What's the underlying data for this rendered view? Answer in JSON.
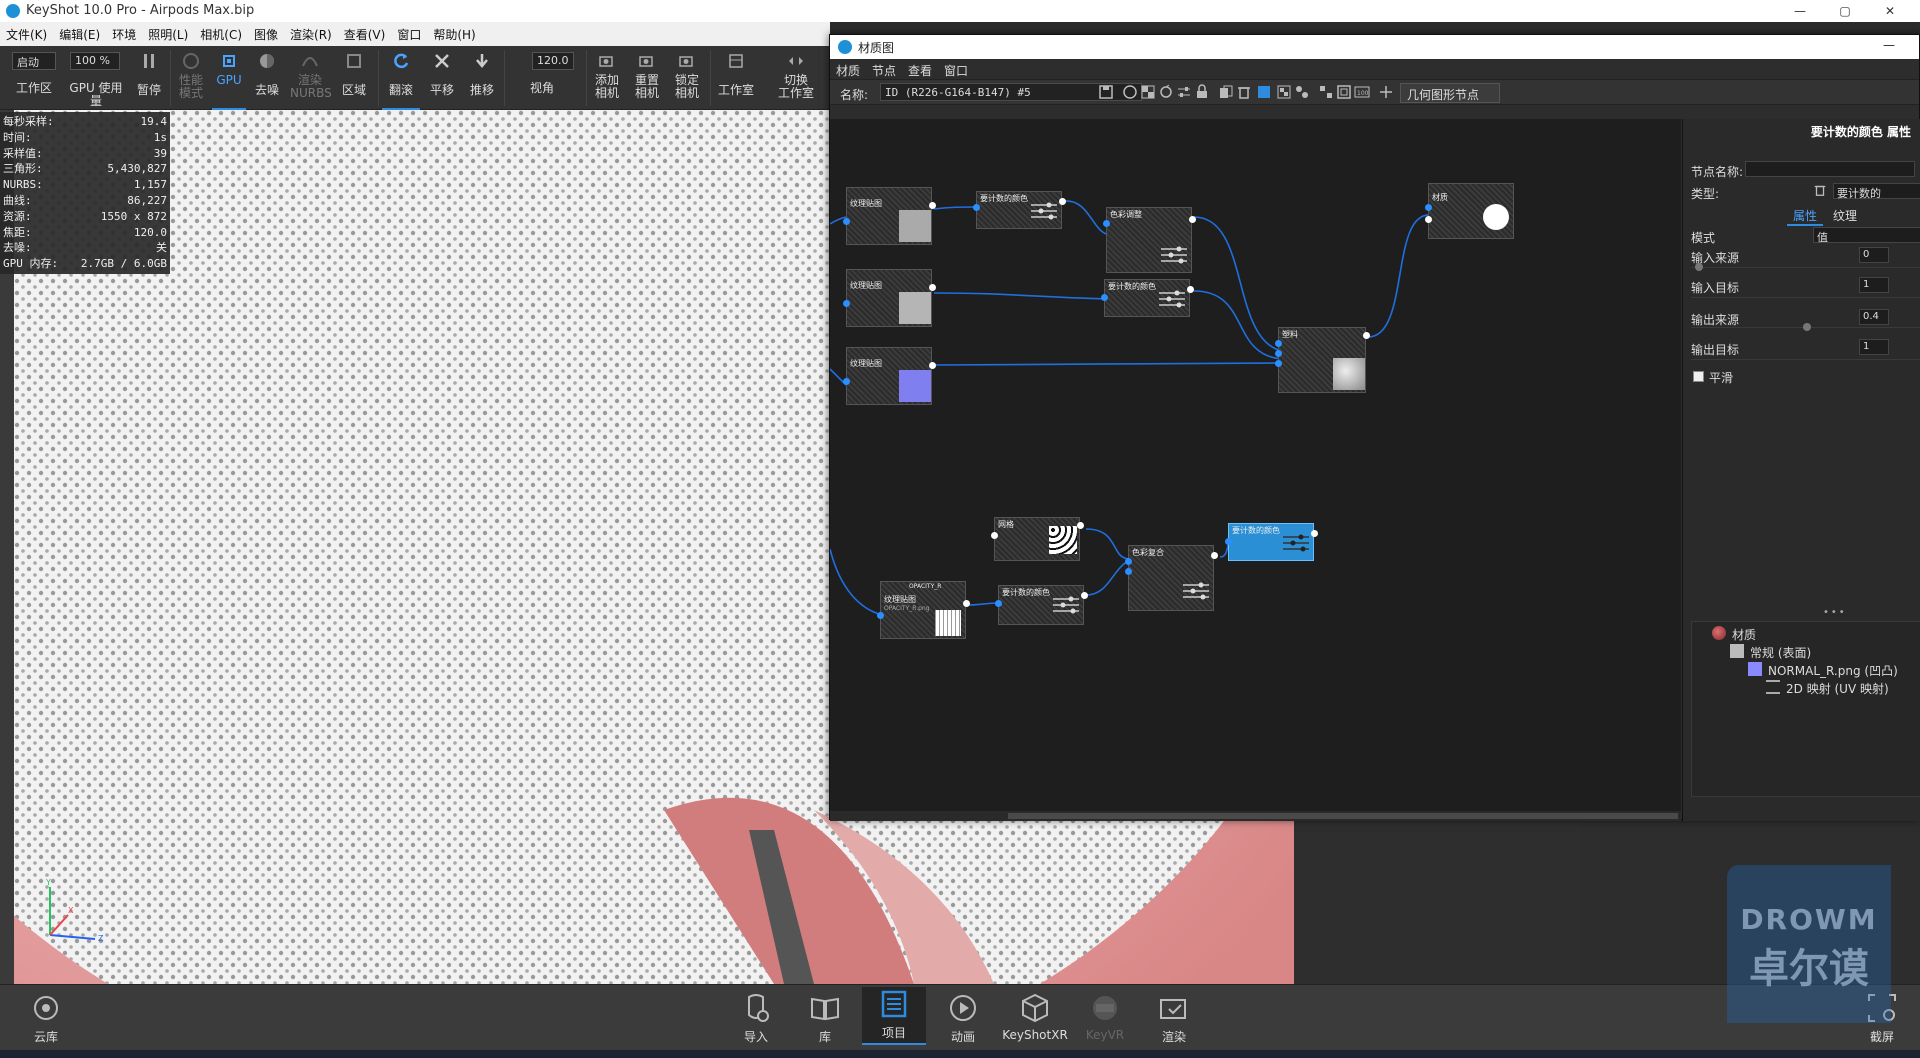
{
  "window": {
    "title": "KeyShot 10.0 Pro  - Airpods Max.bip",
    "minimize": "—",
    "maximize": "▢",
    "close": "✕"
  },
  "menu": [
    "文件(K)",
    "编辑(E)",
    "环境",
    "照明(L)",
    "相机(C)",
    "图像",
    "渲染(R)",
    "查看(V)",
    "窗口",
    "帮助(H)"
  ],
  "toolbar": {
    "start_dropdown": "启动",
    "zoom_value": "100 %",
    "fov_value": "120.0",
    "workspace": "工作区",
    "gpu_usage": "GPU 使用量",
    "pause": "暂停",
    "perf_mode": "性能\n模式",
    "gpu": "GPU",
    "denoise": "去噪",
    "render_nurbs": "渲染\nNURBS",
    "region": "区域",
    "tumble": "翻滚",
    "pan": "平移",
    "dolly": "推移",
    "fov": "视角",
    "add_camera": "添加\n相机",
    "reset_camera": "重置\n相机",
    "lock_camera": "锁定\n相机",
    "studio": "工作室",
    "switch_studio": "切换\n工作室"
  },
  "stats": [
    {
      "label": "每秒采样:",
      "value": "19.4"
    },
    {
      "label": "时间:",
      "value": "1s"
    },
    {
      "label": "采样值:",
      "value": "39"
    },
    {
      "label": "三角形:",
      "value": "5,430,827"
    },
    {
      "label": "NURBS:",
      "value": "1,157"
    },
    {
      "label": "曲线:",
      "value": "86,227"
    },
    {
      "label": "资源:",
      "value": "1550 x 872"
    },
    {
      "label": "焦距:",
      "value": "120.0"
    },
    {
      "label": "去噪:",
      "value": "关"
    },
    {
      "label": "GPU 内存:",
      "value": "2.7GB / 6.0GB"
    }
  ],
  "bottom": {
    "cloud": "云库",
    "import": "导入",
    "library": "库",
    "project": "项目",
    "animation": "动画",
    "keyshotxr": "KeyShotXR",
    "keyvr": "KeyVR",
    "render": "渲染",
    "screenshot": "截屏"
  },
  "material_window": {
    "title": "材质图",
    "minimize": "—",
    "menu": [
      "材质",
      "节点",
      "查看",
      "窗口"
    ],
    "name_label": "名称:",
    "name_value": "ID (R226-G164-B147) #5",
    "geometry_button": "几何图形节点"
  },
  "nodes": {
    "tex1_title": "纹理贴图",
    "tex2_title": "纹理贴图",
    "tex3_title": "纹理贴图",
    "tex4_title": "纹理贴图",
    "count1": "要计数的颜色",
    "count2": "要计数的颜色",
    "count3": "要计数的颜色",
    "count4_selected": "要计数的颜色",
    "adjust": "色彩调整",
    "plastic": "塑料",
    "material": "材质",
    "dots": "网格",
    "composite": "色彩复合",
    "opacity_header": "OPACITY_R",
    "opacity_file": "OPACITY_R.png"
  },
  "props": {
    "header": "要计数的颜色  属性",
    "node_name_label": "节点名称:",
    "node_name_value": "",
    "type_label": "类型:",
    "type_value": "要计数的",
    "tab_properties": "属性",
    "tab_texture": "纹理",
    "mode_label": "模式",
    "mode_value": "值",
    "input_from_label": "输入来源",
    "input_from_value": "0",
    "input_to_label": "输入目标",
    "input_to_value": "1",
    "output_from_label": "输出来源",
    "output_from_value": "0.4",
    "output_to_label": "输出目标",
    "output_to_value": "1",
    "smooth_label": "平滑",
    "dots": "•••"
  },
  "tree": {
    "root": "材质",
    "general": "常规 (表面)",
    "normal": "NORMAL_R.png (凹凸)",
    "mapping": "2D 映射 (UV 映射)"
  },
  "watermark": {
    "line1": "DROWM",
    "line2": "卓尔谟"
  },
  "colors": {
    "accent": "#2d8ce0",
    "selected_node": "#2b8fd6",
    "wire": "#1f6fe0"
  }
}
